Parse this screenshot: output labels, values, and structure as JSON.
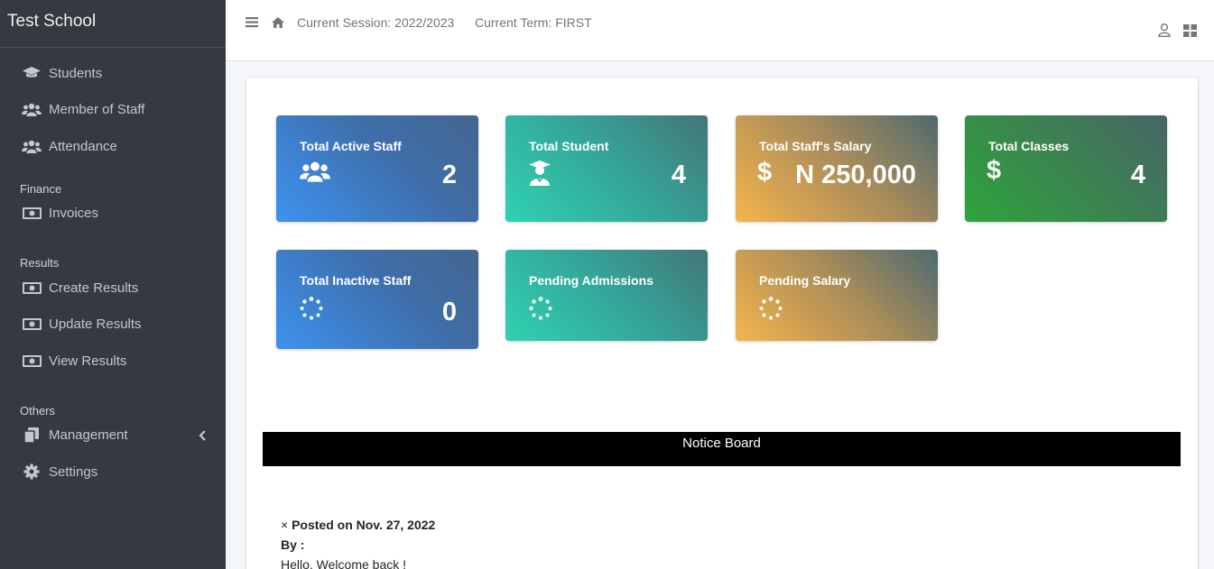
{
  "sidebar": {
    "brand": "Test School",
    "items_main": [
      {
        "label": "Students",
        "icon": "graduation-cap-icon"
      },
      {
        "label": "Member of Staff",
        "icon": "users-icon"
      },
      {
        "label": "Attendance",
        "icon": "users-icon"
      }
    ],
    "finance_header": "Finance",
    "finance_items": [
      {
        "label": "Invoices",
        "icon": "money-bill-icon"
      }
    ],
    "results_header": "Results",
    "results_items": [
      {
        "label": "Create Results",
        "icon": "money-bill-icon"
      },
      {
        "label": "Update Results",
        "icon": "money-bill-icon"
      },
      {
        "label": "View Results",
        "icon": "money-bill-icon"
      }
    ],
    "others_header": "Others",
    "others_items": [
      {
        "label": "Management",
        "icon": "copy-icon"
      },
      {
        "label": "Settings",
        "icon": "gear-icon"
      }
    ]
  },
  "topbar": {
    "session": "Current Session: 2022/2023",
    "term": "Current Term: FIRST"
  },
  "tiles": [
    {
      "title": "Total Active Staff",
      "value": "2",
      "icon": "users-icon"
    },
    {
      "title": "Total Student",
      "value": "4",
      "icon": "user-graduate-icon"
    },
    {
      "title": "Total Staff's Salary",
      "value": "N 250,000",
      "icon": "dollar-icon"
    },
    {
      "title": "Total Classes",
      "value": "4",
      "icon": "dollar-icon"
    },
    {
      "title": "Total Inactive Staff",
      "value": "0",
      "icon": "spinner-icon"
    },
    {
      "title": "Pending Admissions",
      "value": "",
      "icon": "spinner-icon"
    },
    {
      "title": "Pending Salary",
      "value": "",
      "icon": "spinner-icon"
    }
  ],
  "notice": {
    "title": "Notice Board",
    "close_symbol": "×",
    "posted_on": "Posted on Nov. 27, 2022",
    "by_label": "By :",
    "message": "Hello, Welcome back !"
  },
  "colors": {
    "sidebar_bg": "#343a40",
    "blue_tile": "#3c92f0",
    "teal_tile": "#2fd2b1",
    "orange_tile": "#f5b44c",
    "green_tile": "#2ea43c"
  }
}
